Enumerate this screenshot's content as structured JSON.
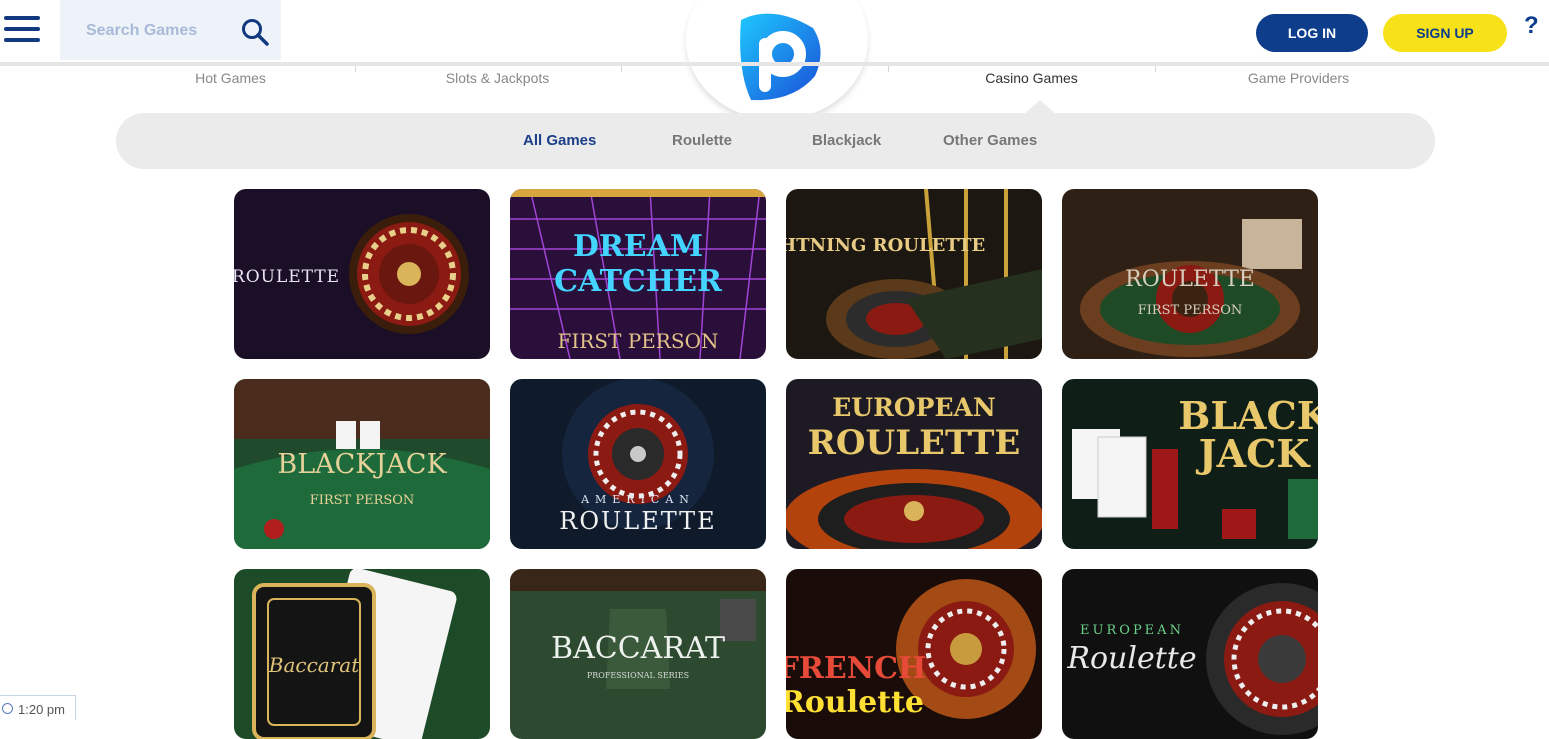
{
  "header": {
    "search_placeholder": "Search Games",
    "login_label": "LOG IN",
    "signup_label": "SIGN UP",
    "help_label": "?"
  },
  "nav": {
    "items": [
      "Hot Games",
      "Slots & Jackpots",
      "",
      "Casino Games",
      "Game Providers"
    ],
    "active": "Casino Games"
  },
  "subnav": {
    "items": [
      "All Games",
      "Roulette",
      "Blackjack",
      "Other Games"
    ],
    "active": "All Games"
  },
  "games": [
    {
      "line1": "ROULETTE",
      "line2": "",
      "bg": "#1a0f26"
    },
    {
      "line1": "DREAM CATCHER",
      "line2": "FIRST PERSON",
      "bg": "#2a0f3a"
    },
    {
      "line1": "LIGHTNING ROULETTE",
      "line2": "",
      "bg": "#1c1710"
    },
    {
      "line1": "ROULETTE",
      "line2": "FIRST PERSON",
      "bg": "#2f2016"
    },
    {
      "line1": "BLACKJACK",
      "line2": "FIRST PERSON",
      "bg": "#1f4a2c"
    },
    {
      "line1": "AMERICAN",
      "line2": "ROULETTE",
      "bg": "#0f1a2b"
    },
    {
      "line1": "EUROPEAN",
      "line2": "ROULETTE",
      "bg": "#1d1a24"
    },
    {
      "line1": "BLACK",
      "line2": "JACK",
      "bg": "#0f1f17"
    },
    {
      "line1": "Baccarat",
      "line2": "",
      "bg": "#1d4a27"
    },
    {
      "line1": "BACCARAT",
      "line2": "PROFESSIONAL SERIES",
      "bg": "#2d4a31"
    },
    {
      "line1": "FRENCH",
      "line2": "Roulette",
      "bg": "#1a0d09"
    },
    {
      "line1": "EUROPEAN",
      "line2": "Roulette",
      "bg": "#101010"
    }
  ],
  "clock": {
    "time": "1:20 pm"
  },
  "colors": {
    "brand_blue": "#0e3d8c",
    "signup_yellow": "#f7e21a"
  }
}
